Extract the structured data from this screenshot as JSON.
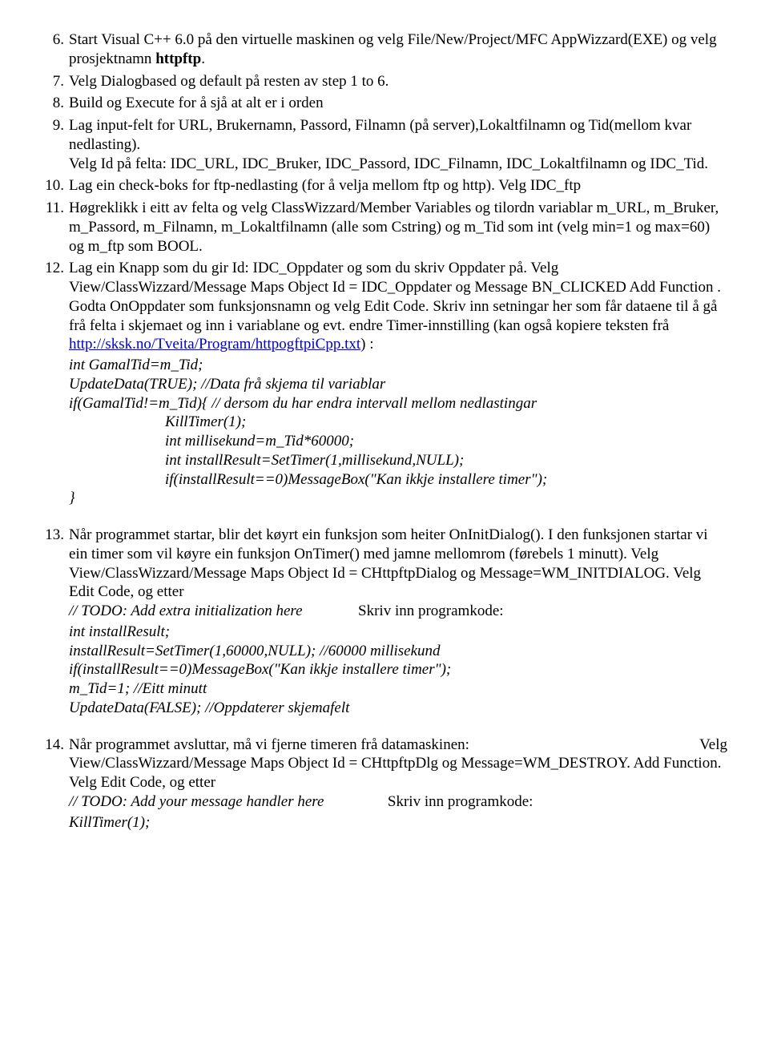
{
  "items": {
    "i6": {
      "num": "6.",
      "t1": "Start Visual C++ 6.0 på den virtuelle maskinen og velg File/New/Project/MFC AppWizzard(EXE) og velg prosjektnamn ",
      "bold": "httpftp",
      "t2": "."
    },
    "i7": {
      "num": "7.",
      "text": "Velg Dialogbased og default på resten av step 1 to 6."
    },
    "i8": {
      "num": "8.",
      "text": "Build og Execute for å sjå at alt er i orden"
    },
    "i9": {
      "num": "9.",
      "p1": "Lag input-felt for URL, Brukernamn, Passord, Filnamn (på server),Lokaltfilnamn og Tid(mellom kvar nedlasting).",
      "p2": "Velg Id på felta: IDC_URL, IDC_Bruker, IDC_Passord, IDC_Filnamn, IDC_Lokaltfilnamn og IDC_Tid."
    },
    "i10": {
      "num": "10.",
      "text": "Lag ein check-boks for ftp-nedlasting (for å velja mellom ftp og http). Velg IDC_ftp"
    },
    "i11": {
      "num": "11.",
      "text": "Høgreklikk i eitt av felta og velg ClassWizzard/Member Variables og tilordn variablar m_URL, m_Bruker, m_Passord, m_Filnamn, m_Lokaltfilnamn (alle som Cstring) og m_Tid som int (velg min=1 og max=60) og m_ftp som BOOL."
    },
    "i12": {
      "num": "12.",
      "t1": "Lag ein Knapp som du gir Id: IDC_Oppdater og som du skriv Oppdater på. Velg View/ClassWizzard/Message Maps   Object Id = IDC_Oppdater og Message BN_CLICKED   Add Function . Godta OnOppdater som funksjonsnamn og velg Edit Code. Skriv inn setningar her som får dataene til å gå frå felta i skjemaet og inn i variablane og evt. endre Timer-innstilling (kan også kopiere teksten frå ",
      "link": "http://sksk.no/Tveita/Program/httpogftpiCpp.txt",
      "t2": ")  :",
      "c1": "int GamalTid=m_Tid;",
      "c2": "UpdateData(TRUE);  //Data frå skjema til variablar",
      "c3": "if(GamalTid!=m_Tid){   // dersom du har endra intervall mellom nedlastingar",
      "c4": "KillTimer(1);",
      "c5": "int millisekund=m_Tid*60000;",
      "c6": "int installResult=SetTimer(1,millisekund,NULL);",
      "c7": "if(installResult==0)MessageBox(\"Kan ikkje installere timer\");",
      "c8": "}"
    },
    "i13": {
      "num": "13.",
      "p1": "Når programmet startar, blir det køyrt ein funksjon som heiter OnInitDialog(). I den funksjonen startar vi ein timer som vil køyre ein funksjon OnTimer() med jamne mellomrom (førebels 1 minutt). Velg View/ClassWizzard/Message Maps   Object Id = CHttpftpDialog og Message=WM_INITDIALOG. Velg Edit Code, og etter",
      "todo": " // TODO: Add extra initialization here",
      "label": "Skriv inn programkode:",
      "c1": "int installResult;",
      "c2": "installResult=SetTimer(1,60000,NULL); //60000 millisekund",
      "c3": "if(installResult==0)MessageBox(\"Kan ikkje installere timer\");",
      "c4": "m_Tid=1; //Eitt minutt",
      "c5": "UpdateData(FALSE); //Oppdaterer skjemafelt"
    },
    "i14": {
      "num": "14.",
      "t1a": "Når programmet avsluttar, må vi fjerne timeren frå datamaskinen:",
      "t1b": "Velg",
      "p2": "View/ClassWizzard/Message Maps   Object Id = CHttpftpDlg og Message=WM_DESTROY.  Add Function. Velg Edit Code, og etter",
      "todo": " // TODO: Add your message handler  here",
      "label": "Skriv inn programkode:",
      "c1": "KillTimer(1);"
    }
  }
}
